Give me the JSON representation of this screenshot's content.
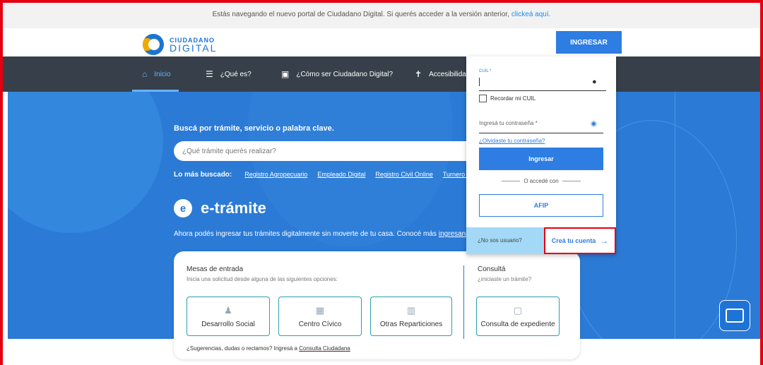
{
  "banner": {
    "text": "Estás navegando el nuevo portal de Ciudadano Digital. Si querés acceder a la versión anterior,",
    "link": "clickeá aquí."
  },
  "header": {
    "logo_line1": "CIUDADANO",
    "logo_line2": "DIGITAL",
    "login_button": "INGRESAR"
  },
  "nav": {
    "items": [
      {
        "label": "Inicio",
        "icon": "home-icon",
        "active": true
      },
      {
        "label": "¿Qué es?",
        "icon": "list-icon"
      },
      {
        "label": "¿Cómo ser Ciudadano Digital?",
        "icon": "id-card-icon"
      },
      {
        "label": "Accesibilidad",
        "icon": "accessibility-icon"
      }
    ]
  },
  "search": {
    "label": "Buscá por trámite, servicio o palabra clave.",
    "placeholder": "¿Qué trámite querés realizar?"
  },
  "popular": {
    "label": "Lo más buscado:",
    "items": [
      "Registro Agropecuario",
      "Empleado Digital",
      "Registro Civil Online",
      "Turnero W"
    ]
  },
  "etramite": {
    "icon_letter": "e",
    "title": "e-trámite",
    "desc": "Ahora podés ingresar tus trámites digitalmente sin moverte de tu casa. Conocé más",
    "link": "ingresando"
  },
  "card": {
    "mesas_title": "Mesas de entrada",
    "mesas_sub": "Inicia una solicitud desde alguna de las siguientes opciones:",
    "options": [
      "Desarrollo Social",
      "Centro Cívico",
      "Otras Reparticiones"
    ],
    "consulta_title": "Consultá",
    "consulta_sub": "¿iniciaste un trámite?",
    "consulta_option": "Consulta de expediente",
    "footer_text": "¿Sugerencias, dudas o reclamos? Ingresá a",
    "footer_link": "Consulta Ciudadana"
  },
  "login": {
    "cuil_label": "CUIL *",
    "remember": "Recordar mi CUIL",
    "password_placeholder": "Ingresá tu contraseña *",
    "forgot": "¿Olvidaste tu contraseña?",
    "submit": "Ingresar",
    "or_text": "O accedé con",
    "afip": "AFIP",
    "not_user": "¿No sos usuario?",
    "create": "Creá tu cuenta"
  },
  "colors": {
    "accent": "#2d7de2",
    "hero": "#2b7ad6",
    "nav": "#37404a",
    "highlight": "#e3000f"
  }
}
